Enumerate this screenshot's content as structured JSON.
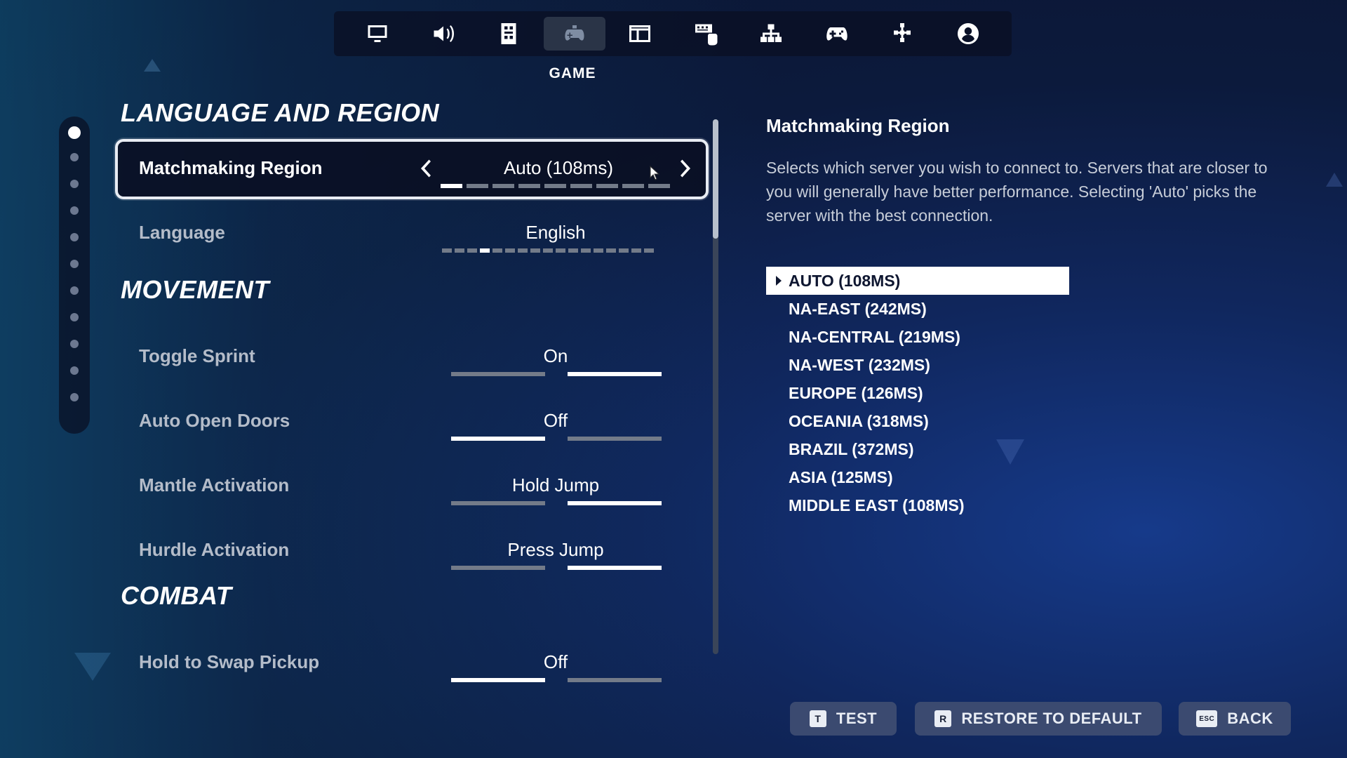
{
  "nav": {
    "tabs": [
      {
        "icon": "monitor-icon"
      },
      {
        "icon": "speaker-icon"
      },
      {
        "icon": "accessibility-icon"
      },
      {
        "icon": "game-controller-icon",
        "active": true
      },
      {
        "icon": "hud-layout-icon"
      },
      {
        "icon": "keyboard-mouse-icon"
      },
      {
        "icon": "network-icon"
      },
      {
        "icon": "gamepad-icon"
      },
      {
        "icon": "controller-layout-icon"
      },
      {
        "icon": "account-icon"
      }
    ],
    "active_label": "GAME"
  },
  "sections": {
    "language_region": "LANGUAGE AND REGION",
    "movement": "MOVEMENT",
    "combat": "COMBAT"
  },
  "settings": {
    "matchmaking_region": {
      "label": "Matchmaking Region",
      "value": "Auto (108ms)",
      "position": 1,
      "count": 9
    },
    "language": {
      "label": "Language",
      "value": "English",
      "position": 4,
      "count": 17
    },
    "toggle_sprint": {
      "label": "Toggle Sprint",
      "value": "On"
    },
    "auto_open_doors": {
      "label": "Auto Open Doors",
      "value": "Off"
    },
    "mantle_activation": {
      "label": "Mantle Activation",
      "value": "Hold Jump"
    },
    "hurdle_activation": {
      "label": "Hurdle Activation",
      "value": "Press Jump"
    },
    "hold_to_swap_pickup": {
      "label": "Hold to Swap Pickup",
      "value": "Off"
    }
  },
  "detail": {
    "title": "Matchmaking Region",
    "description": "Selects which server you wish to connect to. Servers that are closer to you will generally have better performance. Selecting 'Auto' picks the server with the best connection.",
    "options": [
      "AUTO (108MS)",
      "NA-EAST (242MS)",
      "NA-CENTRAL (219MS)",
      "NA-WEST (232MS)",
      "EUROPE (126MS)",
      "OCEANIA (318MS)",
      "BRAZIL (372MS)",
      "ASIA (125MS)",
      "MIDDLE EAST (108MS)"
    ],
    "selected_option": "AUTO (108MS)"
  },
  "footer": {
    "test": {
      "key": "T",
      "label": "TEST"
    },
    "restore": {
      "key": "R",
      "label": "RESTORE TO DEFAULT"
    },
    "back": {
      "key": "ESC",
      "label": "BACK"
    }
  },
  "colors": {
    "accent_button": "#3b4a70",
    "selected_border": "#e8ecf3"
  }
}
